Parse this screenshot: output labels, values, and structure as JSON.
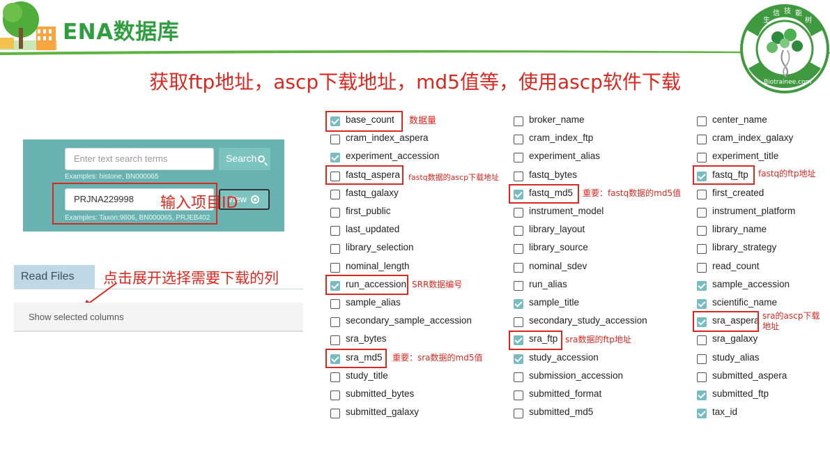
{
  "header": {
    "title": "ENA数据库",
    "subtitle": "获取ftp地址，ascp下载地址，md5值等，使用ascp软件下载",
    "logo_text": "生信技能树",
    "logo_url": "Biotrainee.com"
  },
  "search": {
    "placeholder": "Enter text search terms",
    "search_label": "Search",
    "examples_top": "Examples: histone, BN000065",
    "id_value": "PRJNA229998",
    "view_label": "View",
    "examples_bottom": "Examples: Taxon:9606, BN000065, PRJEB402",
    "note": "输入项目ID"
  },
  "read_files": {
    "tab_label": "Read Files",
    "show_columns_label": "Show selected columns",
    "note": "点击展开选择需要下载的列"
  },
  "columns": {
    "col1": [
      {
        "label": "base_count",
        "checked": true
      },
      {
        "label": "cram_index_aspera",
        "checked": false
      },
      {
        "label": "experiment_accession",
        "checked": true
      },
      {
        "label": "fastq_aspera",
        "checked": false
      },
      {
        "label": "fastq_galaxy",
        "checked": false
      },
      {
        "label": "first_public",
        "checked": false
      },
      {
        "label": "last_updated",
        "checked": false
      },
      {
        "label": "library_selection",
        "checked": false
      },
      {
        "label": "nominal_length",
        "checked": false
      },
      {
        "label": "run_accession",
        "checked": true
      },
      {
        "label": "sample_alias",
        "checked": false
      },
      {
        "label": "secondary_sample_accession",
        "checked": false
      },
      {
        "label": "sra_bytes",
        "checked": false
      },
      {
        "label": "sra_md5",
        "checked": true
      },
      {
        "label": "study_title",
        "checked": false
      },
      {
        "label": "submitted_bytes",
        "checked": false
      },
      {
        "label": "submitted_galaxy",
        "checked": false
      }
    ],
    "col2": [
      {
        "label": "broker_name",
        "checked": false
      },
      {
        "label": "cram_index_ftp",
        "checked": false
      },
      {
        "label": "experiment_alias",
        "checked": false
      },
      {
        "label": "fastq_bytes",
        "checked": false
      },
      {
        "label": "fastq_md5",
        "checked": true
      },
      {
        "label": "instrument_model",
        "checked": false
      },
      {
        "label": "library_layout",
        "checked": false
      },
      {
        "label": "library_source",
        "checked": false
      },
      {
        "label": "nominal_sdev",
        "checked": false
      },
      {
        "label": "run_alias",
        "checked": false
      },
      {
        "label": "sample_title",
        "checked": true
      },
      {
        "label": "secondary_study_accession",
        "checked": false
      },
      {
        "label": "sra_ftp",
        "checked": true
      },
      {
        "label": "study_accession",
        "checked": true
      },
      {
        "label": "submission_accession",
        "checked": false
      },
      {
        "label": "submitted_format",
        "checked": false
      },
      {
        "label": "submitted_md5",
        "checked": false
      }
    ],
    "col3": [
      {
        "label": "center_name",
        "checked": false
      },
      {
        "label": "cram_index_galaxy",
        "checked": false
      },
      {
        "label": "experiment_title",
        "checked": false
      },
      {
        "label": "fastq_ftp",
        "checked": true
      },
      {
        "label": "first_created",
        "checked": false
      },
      {
        "label": "instrument_platform",
        "checked": false
      },
      {
        "label": "library_name",
        "checked": false
      },
      {
        "label": "library_strategy",
        "checked": false
      },
      {
        "label": "read_count",
        "checked": false
      },
      {
        "label": "sample_accession",
        "checked": true
      },
      {
        "label": "scientific_name",
        "checked": true
      },
      {
        "label": "sra_aspera",
        "checked": true
      },
      {
        "label": "sra_galaxy",
        "checked": false
      },
      {
        "label": "study_alias",
        "checked": false
      },
      {
        "label": "submitted_aspera",
        "checked": false
      },
      {
        "label": "submitted_ftp",
        "checked": true
      },
      {
        "label": "tax_id",
        "checked": true
      }
    ]
  },
  "annotations": {
    "base_count": "数据量",
    "fastq_aspera": "fastq数据的ascp下载地址",
    "fastq_ftp": "fastq的ftp地址",
    "fastq_md5": "重要：fastq数据的md5值",
    "run_accession": "SRR数据编号",
    "sra_aspera_1": "sra的ascp下载",
    "sra_aspera_2": "地址",
    "sra_ftp": "sra数据的ftp地址",
    "sra_md5": "重要：sra数据的md5值"
  },
  "colors": {
    "title_green": "#2e9e3f",
    "annotation_red": "#d9281f",
    "panel_teal": "#68b3b1",
    "checkbox_teal": "#78bcc1"
  }
}
